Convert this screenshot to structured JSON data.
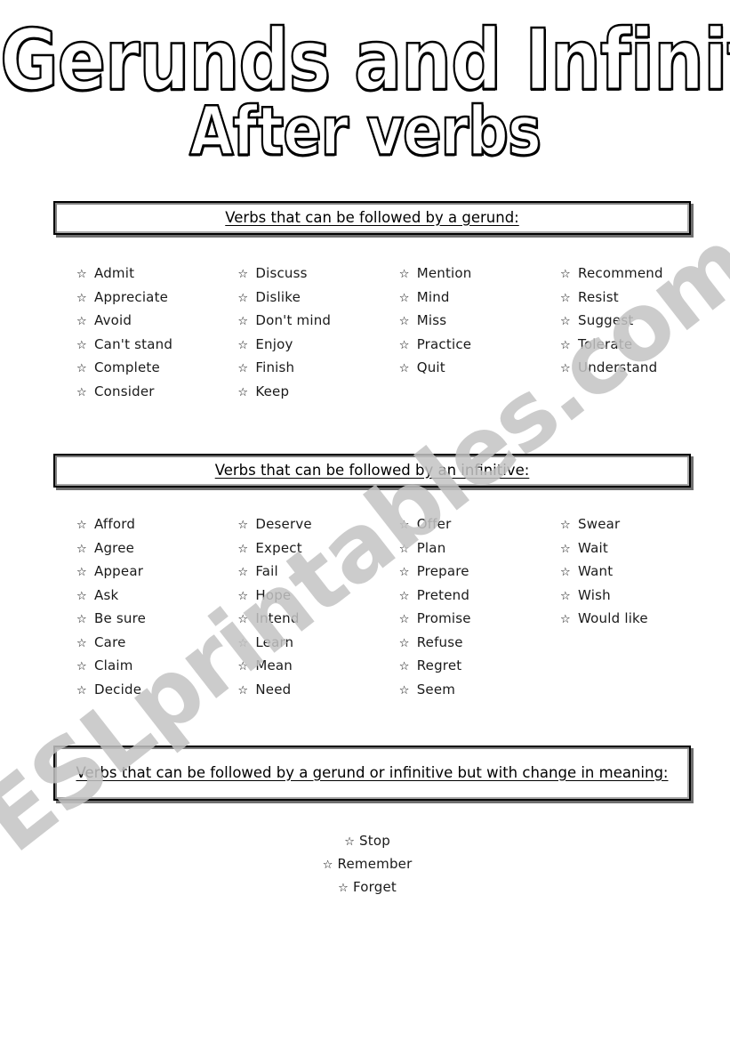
{
  "title": {
    "line1": "Gerunds and Infinitives",
    "line2": "After verbs"
  },
  "watermark": {
    "text": "ESLprintables.com",
    "color": "#c4c4c4"
  },
  "bullet": {
    "icon": "hollow-star",
    "glyph": "☆"
  },
  "colors": {
    "text": "#000000",
    "box_border": "#000000",
    "box_shadow": "#6e6e6e",
    "box_inner_shade": "#808080",
    "page_background": "#ffffff"
  },
  "sections": [
    {
      "id": "gerund",
      "header": "Verbs that can be followed by a gerund:",
      "columns": [
        [
          "Admit",
          "Appreciate",
          "Avoid",
          "Can't stand",
          "Complete",
          "Consider"
        ],
        [
          "Discuss",
          "Dislike",
          "Don't mind",
          "Enjoy",
          "Finish",
          "Keep"
        ],
        [
          "Mention",
          "Mind",
          "Miss",
          "Practice",
          "Quit"
        ],
        [
          "Recommend",
          "Resist",
          "Suggest",
          "Tolerate",
          "Understand"
        ]
      ]
    },
    {
      "id": "infinitive",
      "header": "Verbs that can be followed by an infinitive:",
      "columns": [
        [
          "Afford",
          "Agree",
          "Appear",
          "Ask",
          "Be sure",
          "Care",
          "Claim",
          "Decide"
        ],
        [
          "Deserve",
          "Expect",
          "Fail",
          "Hope",
          "Intend",
          "Learn",
          "Mean",
          "Need"
        ],
        [
          "Offer",
          "Plan",
          "Prepare",
          "Pretend",
          "Promise",
          "Refuse",
          "Regret",
          "Seem"
        ],
        [
          "Swear",
          "Wait",
          "Want",
          "Wish",
          "Would like"
        ]
      ]
    },
    {
      "id": "both",
      "header": "Verbs that can be followed by a gerund or infinitive but with change in meaning:",
      "items": [
        "Stop",
        "Remember",
        "Forget"
      ]
    }
  ]
}
